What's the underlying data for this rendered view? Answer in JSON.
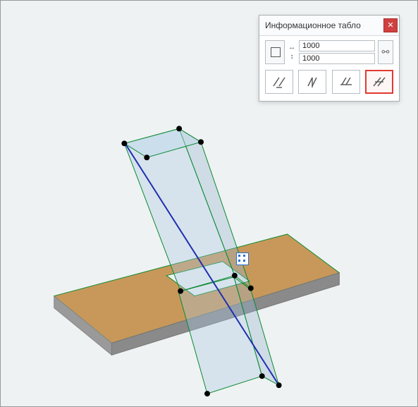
{
  "palette": {
    "title": "Информационное табло",
    "width_value": "1000",
    "height_value": "1000",
    "modes": {
      "m1": "cut-both-sides",
      "m2": "cut-vertical",
      "m3": "cut-horizontal",
      "m4": "cut-angled"
    }
  }
}
